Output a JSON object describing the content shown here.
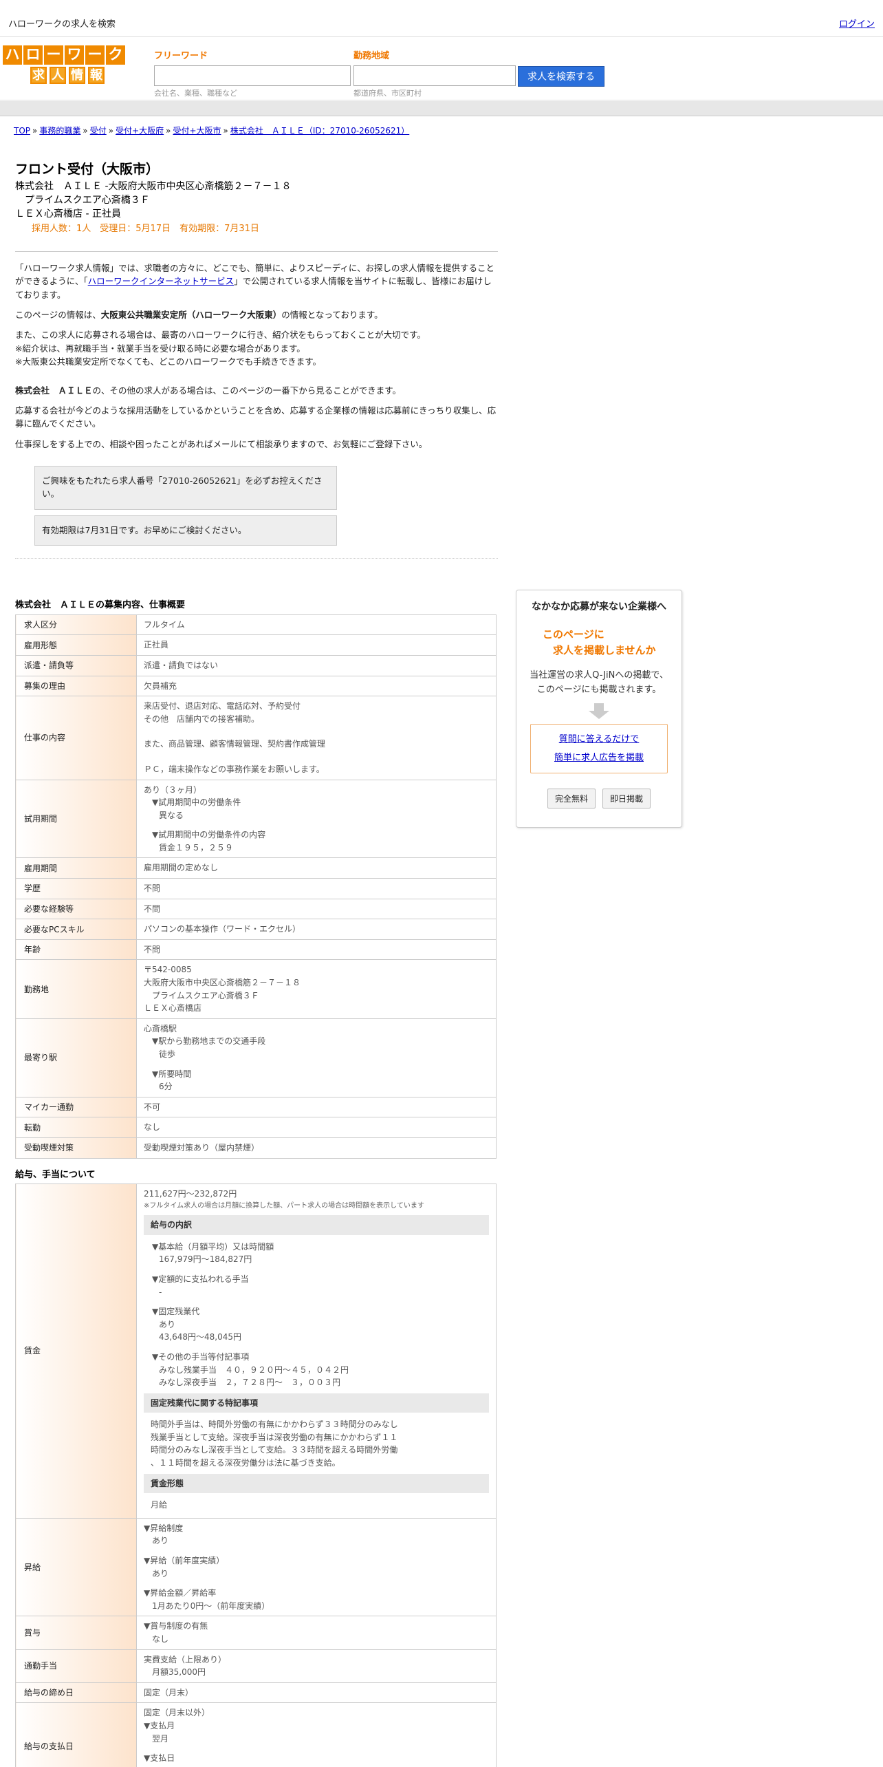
{
  "topbar": {
    "site_title": "ハローワークの求人を検索",
    "login": "ログイン"
  },
  "logo": {
    "row1": [
      "ハ",
      "ロ",
      "ー",
      "ワ",
      "ー",
      "ク"
    ],
    "row2": [
      "求",
      "人",
      "情",
      "報"
    ]
  },
  "search": {
    "free_label": "フリーワード",
    "free_value": "",
    "free_hint": "会社名、業種、職種など",
    "area_label": "勤務地域",
    "area_value": "",
    "area_hint": "都道府県、市区町村",
    "button": "求人を検索する"
  },
  "breadcrumb": [
    "TOP",
    "事務的職業",
    "受付",
    "受付+大阪府",
    "受付+大阪市",
    "株式会社　ＡＩＬＥ（ID：27010-26052621）"
  ],
  "job": {
    "title": "フロント受付（大阪市）",
    "company_line1": "株式会社　ＡＩＬＥ -大阪府大阪市中央区心斎橋筋２－７－１８",
    "company_line2": "　プライムスクエア心斎橋３Ｆ",
    "company_line3": "ＬＥＸ心斎橋店 - 正社員",
    "info": "採用人数：1人　受理日：5月17日　有効期限：7月31日"
  },
  "intro": {
    "p1_a": "「ハローワーク求人情報」では、求職者の方々に、どこでも、簡単に、よりスピーディに、お探しの求人情報を提供することができるように、「",
    "p1_link": "ハローワークインターネットサービス",
    "p1_b": "」で公開されている求人情報を当サイトに転載し、皆様にお届けしております。",
    "p2_a": "このページの情報は、",
    "p2_bold": "大阪東公共職業安定所（ハローワーク大阪東）",
    "p2_b": "の情報となっております。",
    "p3_l1": "また、この求人に応募される場合は、最寄のハローワークに行き、紹介状をもらっておくことが大切です。",
    "p3_l2": "※紹介状は、再就職手当・就業手当を受け取る時に必要な場合があります。",
    "p3_l3": "※大阪東公共職業安定所でなくても、どこのハローワークでも手続きできます。",
    "p4_bold": "株式会社　ＡＩＬＥ",
    "p4_b": "の、その他の求人がある場合は、このページの一番下から見ることができます。",
    "p5": "応募する会社が今どのような採用活動をしているかということを含め、応募する企業様の情報は応募前にきっちり収集し、応募に臨んでください。",
    "p6": "仕事探しをする上での、相談や困ったことがあればメールにて相談承りますので、お気軽にご登録下さい。",
    "box1": "ご興味をもたれたら求人番号「27010-26052621」を必ずお控えください。",
    "box2": "有効期限は7月31日です。お早めにご検討ください。"
  },
  "overview": {
    "title": "株式会社　ＡＩＬＥの募集内容、仕事概要",
    "rows": {
      "kyujin_kubun": {
        "label": "求人区分",
        "value": "フルタイム"
      },
      "koyo_keitai": {
        "label": "雇用形態",
        "value": "正社員"
      },
      "haken": {
        "label": "派遣・請負等",
        "value": "派遣・請負ではない"
      },
      "riyu": {
        "label": "募集の理由",
        "value": "欠員補充"
      },
      "shigoto": {
        "label": "仕事の内容",
        "l1": "来店受付、退店対応、電話応対、予約受付",
        "l2": "その他　店舗内での接客補助。",
        "l3": "また、商品管理、顧客情報管理、契約書作成管理",
        "l4": "ＰＣ，端末操作などの事務作業をお願いします。"
      },
      "shiyo": {
        "label": "試用期間",
        "l1": "あり（３ヶ月）",
        "l2": "▼試用期間中の労働条件",
        "l3": "異なる",
        "l4": "▼試用期間中の労働条件の内容",
        "l5": "賃金１９５，２５９"
      },
      "koyo_kikan": {
        "label": "雇用期間",
        "value": "雇用期間の定めなし"
      },
      "gakureki": {
        "label": "学歴",
        "value": "不問"
      },
      "keiken": {
        "label": "必要な経験等",
        "value": "不問"
      },
      "pc": {
        "label": "必要なPCスキル",
        "value": "パソコンの基本操作（ワード・エクセル）"
      },
      "nenrei": {
        "label": "年齢",
        "value": "不問"
      },
      "kinmuchi": {
        "label": "勤務地",
        "l1": "〒542-0085",
        "l2": "大阪府大阪市中央区心斎橋筋２－７－１８",
        "l3": "　プライムスクエア心斎橋３Ｆ",
        "l4": "ＬＥＸ心斎橋店"
      },
      "eki": {
        "label": "最寄り駅",
        "l1": "心斎橋駅",
        "l2": "▼駅から勤務地までの交通手段",
        "l3": "徒歩",
        "l4": "▼所要時間",
        "l5": "6分"
      },
      "mycar": {
        "label": "マイカー通勤",
        "value": "不可"
      },
      "tenkin": {
        "label": "転勤",
        "value": "なし"
      },
      "kitsuen": {
        "label": "受動喫煙対策",
        "value": "受動喫煙対策あり（屋内禁煙）"
      }
    }
  },
  "salary": {
    "title": "給与、手当について",
    "chingin": {
      "label": "賃金",
      "range": "211,627円〜232,872円",
      "note": "※フルタイム求人の場合は月額に換算した額、パート求人の場合は時間額を表示しています",
      "breakdown_head": "給与の内訳",
      "b1": "▼基本給（月額平均）又は時間額",
      "b1v": "167,979円〜184,827円",
      "b2": "▼定額的に支払われる手当",
      "b2v": "-",
      "b3": "▼固定残業代",
      "b3v1": "あり",
      "b3v2": "43,648円〜48,045円",
      "b4": "▼その他の手当等付記事項",
      "b4v1": "みなし残業手当　４０，９２０円～４５，０４２円",
      "b4v2": "みなし深夜手当　２，７２８円～　３，００３円",
      "fixed_head": "固定残業代に関する特記事項",
      "f1": "時間外手当は、時間外労働の有無にかかわらず３３時間分のみなし",
      "f2": "残業手当として支給。深夜手当は深夜労働の有無にかかわらず１１",
      "f3": "時間分のみなし深夜手当として支給。３３時間を超える時間外労働",
      "f4": "、１１時間を超える深夜労働分は法に基づき支給。",
      "form_head": "賃金形態",
      "form": "月給"
    },
    "shokyu": {
      "label": "昇給",
      "l1": "▼昇給制度",
      "l1v": "あり",
      "l2": "▼昇給（前年度実績）",
      "l2v": "あり",
      "l3": "▼昇給金額／昇給率",
      "l3v": "1月あたり0円〜（前年度実績）"
    },
    "shoyo": {
      "label": "賞与",
      "l1": "▼賞与制度の有無",
      "l1v": "なし"
    },
    "tsukin": {
      "label": "通勤手当",
      "l1": "実費支給（上限あり）",
      "l1v": "月額35,000円"
    },
    "shimebi": {
      "label": "給与の締め日",
      "value": "固定（月末）"
    },
    "shiharai": {
      "label": "給与の支払日",
      "l1": "固定（月末以外）",
      "l2": "▼支払月",
      "l2v": "翌月",
      "l3": "▼支払日"
    }
  },
  "ad": {
    "title": "なかなか応募が来ない企業様へ",
    "orange1": "このページに",
    "orange2": "　求人を掲載しませんか",
    "text1": "当社運営の求人Q-JiNへの掲載で、",
    "text2": "このページにも掲載されます。",
    "link1": "質問に答えるだけで",
    "link2": "簡単に求人広告を掲載",
    "btn1": "完全無料",
    "btn2": "即日掲載"
  }
}
